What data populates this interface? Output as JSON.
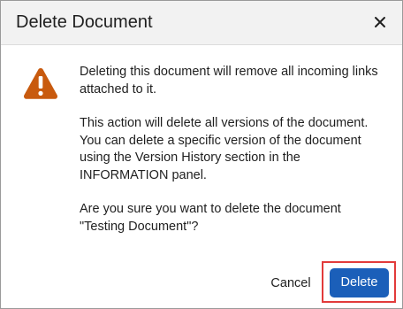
{
  "dialog": {
    "title": "Delete Document",
    "close_icon": "close-icon",
    "warning_icon": "warning-triangle-icon",
    "paragraphs": [
      "Deleting this document will remove all incoming links attached to it.",
      "This action will delete all versions of the document. You can delete a specific version of the document using the Version History section in the INFORMATION panel.",
      "Are you sure you want to delete the document \"Testing Document\"?"
    ],
    "cancel_label": "Cancel",
    "delete_label": "Delete"
  },
  "colors": {
    "primary": "#1b5fb9",
    "warning": "#c85a0e",
    "highlight": "#e23b3b",
    "header_bg": "#f2f2f2"
  }
}
